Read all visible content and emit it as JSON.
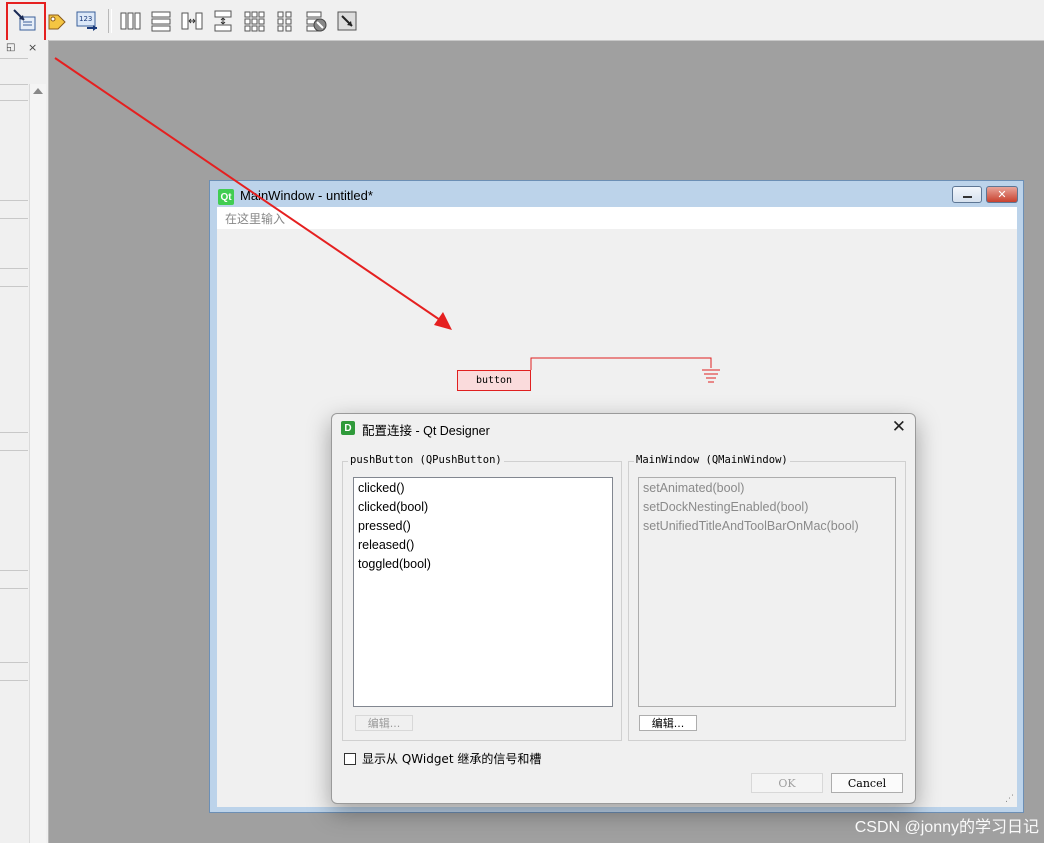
{
  "main_window": {
    "title": "MainWindow - untitled*",
    "menu_hint": "在这里输入",
    "qt_badge": "Qt"
  },
  "widget": {
    "label": "button"
  },
  "dialog": {
    "title": "配置连接 - Qt Designer",
    "badge": "D",
    "sender_group": "pushButton (QPushButton)",
    "sender_signals": [
      "clicked()",
      "clicked(bool)",
      "pressed()",
      "released()",
      "toggled(bool)"
    ],
    "sender_edit": "编辑...",
    "receiver_group": "MainWindow (QMainWindow)",
    "receiver_slots": [
      "setAnimated(bool)",
      "setDockNestingEnabled(bool)",
      "setUnifiedTitleAndToolBarOnMac(bool)"
    ],
    "receiver_edit": "编辑...",
    "checkbox_label": "显示从 QWidget 继承的信号和槽",
    "checkbox_checked": false,
    "ok_label": "OK",
    "cancel_label": "Cancel"
  },
  "toolbar": {
    "icons": [
      "edit-signals-slots-icon",
      "edit-buddies-icon",
      "edit-tab-order-icon",
      "layout-horizontal-icon",
      "layout-vertical-icon",
      "layout-h-splitter-icon",
      "layout-v-splitter-icon",
      "layout-grid-icon",
      "layout-form-icon",
      "break-layout-icon",
      "adjust-size-icon"
    ]
  },
  "watermark": "CSDN @jonny的学习日记",
  "colors": {
    "highlight": "#e52020",
    "connection": "#e02020",
    "widget_fill": "#fadbdc"
  }
}
